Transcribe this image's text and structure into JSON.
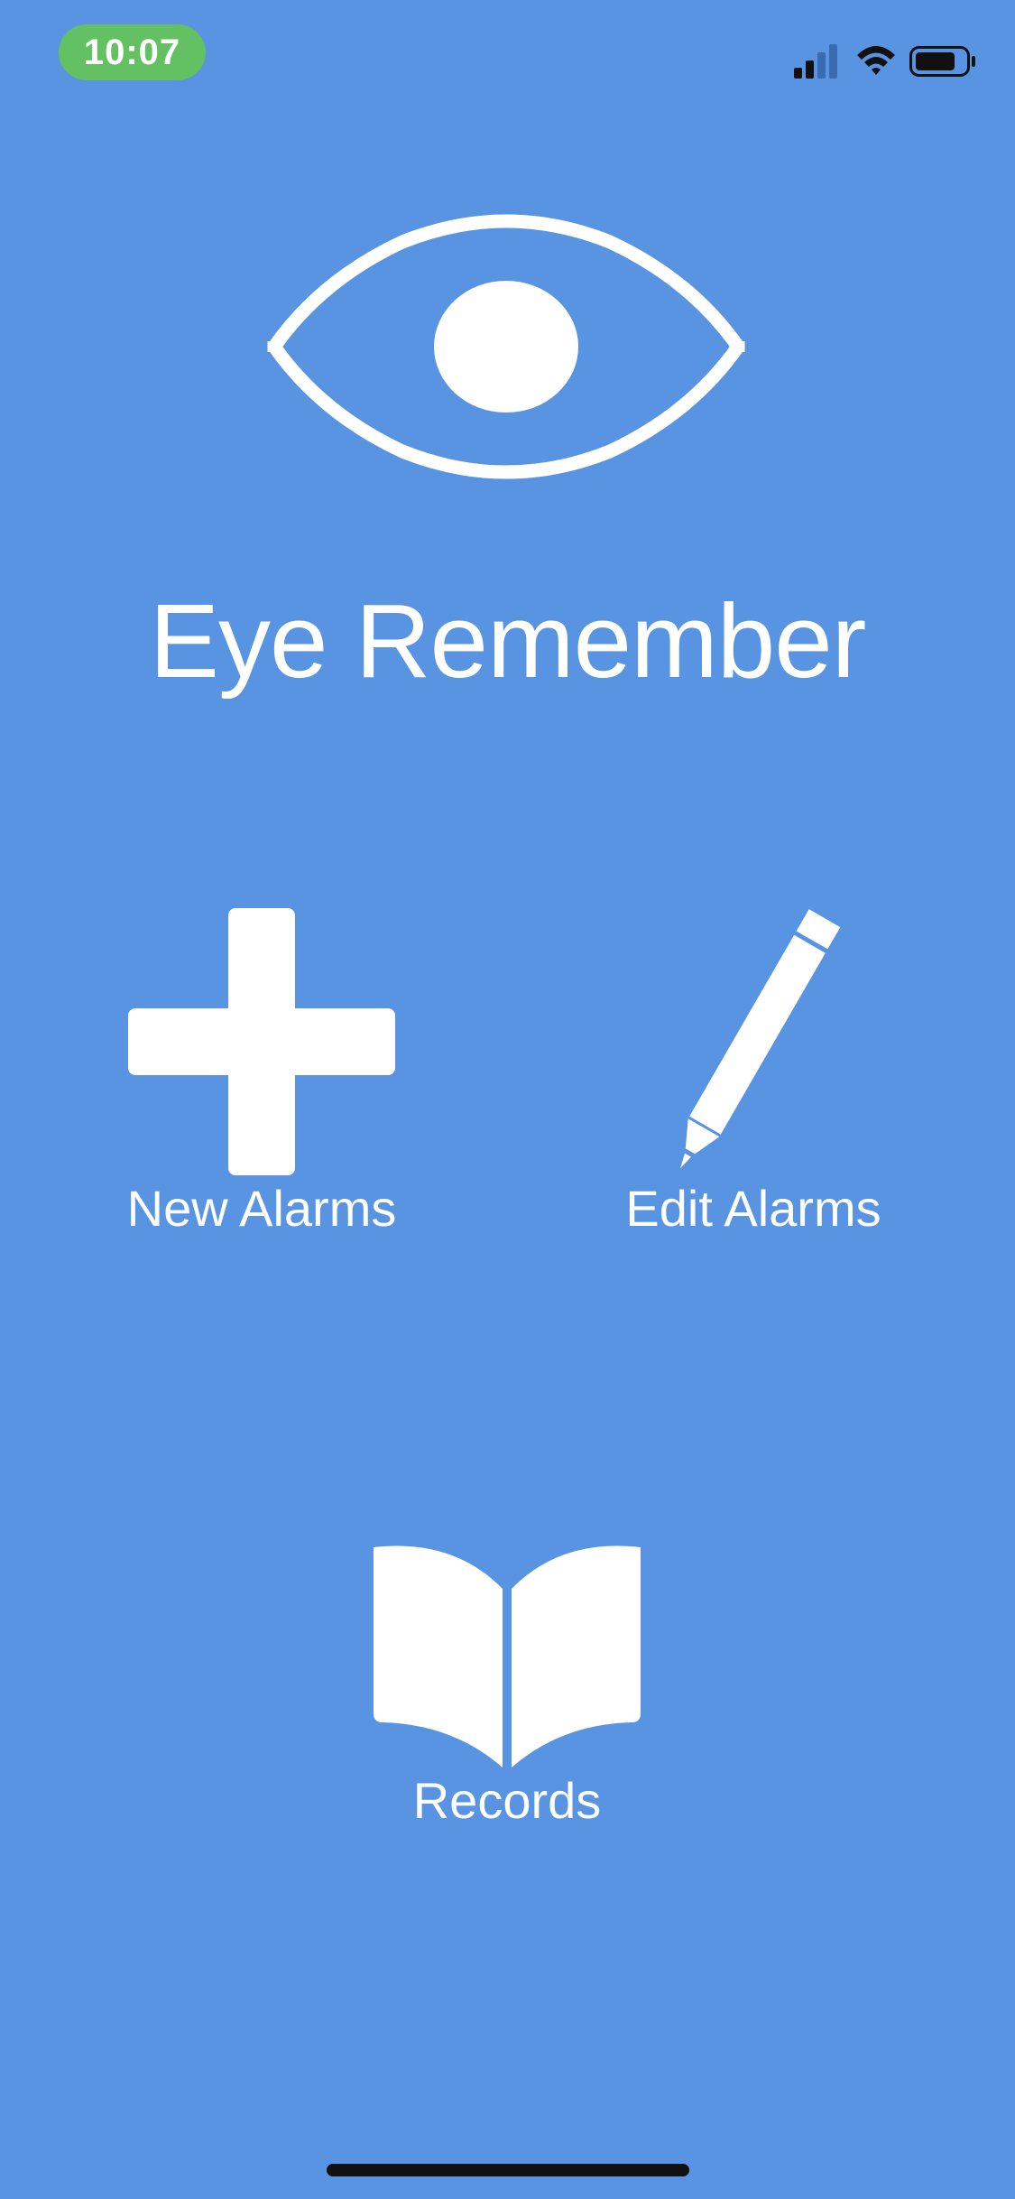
{
  "status_bar": {
    "time": "10:07",
    "time_pill_color": "#63c063",
    "signal_icon": "cellular-signal-icon",
    "wifi_icon": "wifi-icon",
    "battery_icon": "battery-icon"
  },
  "app": {
    "background_color": "#5894e2",
    "logo_icon": "eye-icon",
    "title": "Eye Remember"
  },
  "actions": {
    "new_alarms": {
      "label": "New Alarms",
      "icon": "plus-icon"
    },
    "edit_alarms": {
      "label": "Edit Alarms",
      "icon": "pencil-icon"
    },
    "records": {
      "label": "Records",
      "icon": "book-icon"
    }
  }
}
